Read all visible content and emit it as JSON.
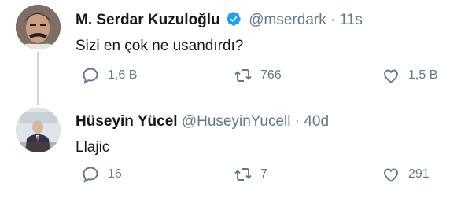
{
  "tweets": [
    {
      "name": "M. Serdar Kuzuloğlu",
      "handle": "@mserdark",
      "separator": "·",
      "time": "11s",
      "text": "Sizi en çok ne usandırdı?",
      "reply_count": "1,6 B",
      "retweet_count": "766",
      "like_count": "1,5 B",
      "verified": true
    },
    {
      "name": "Hüseyin Yücel",
      "handle": "@HuseyinYucell",
      "separator": "·",
      "time": "40d",
      "text": "Llajic",
      "reply_count": "16",
      "retweet_count": "7",
      "like_count": "291"
    }
  ],
  "colors": {
    "verified": "#1da1f2",
    "meta": "#657786",
    "divider": "#e6ecf0"
  },
  "icons": [
    "reply-icon",
    "retweet-icon",
    "like-icon",
    "verified-badge-icon"
  ]
}
